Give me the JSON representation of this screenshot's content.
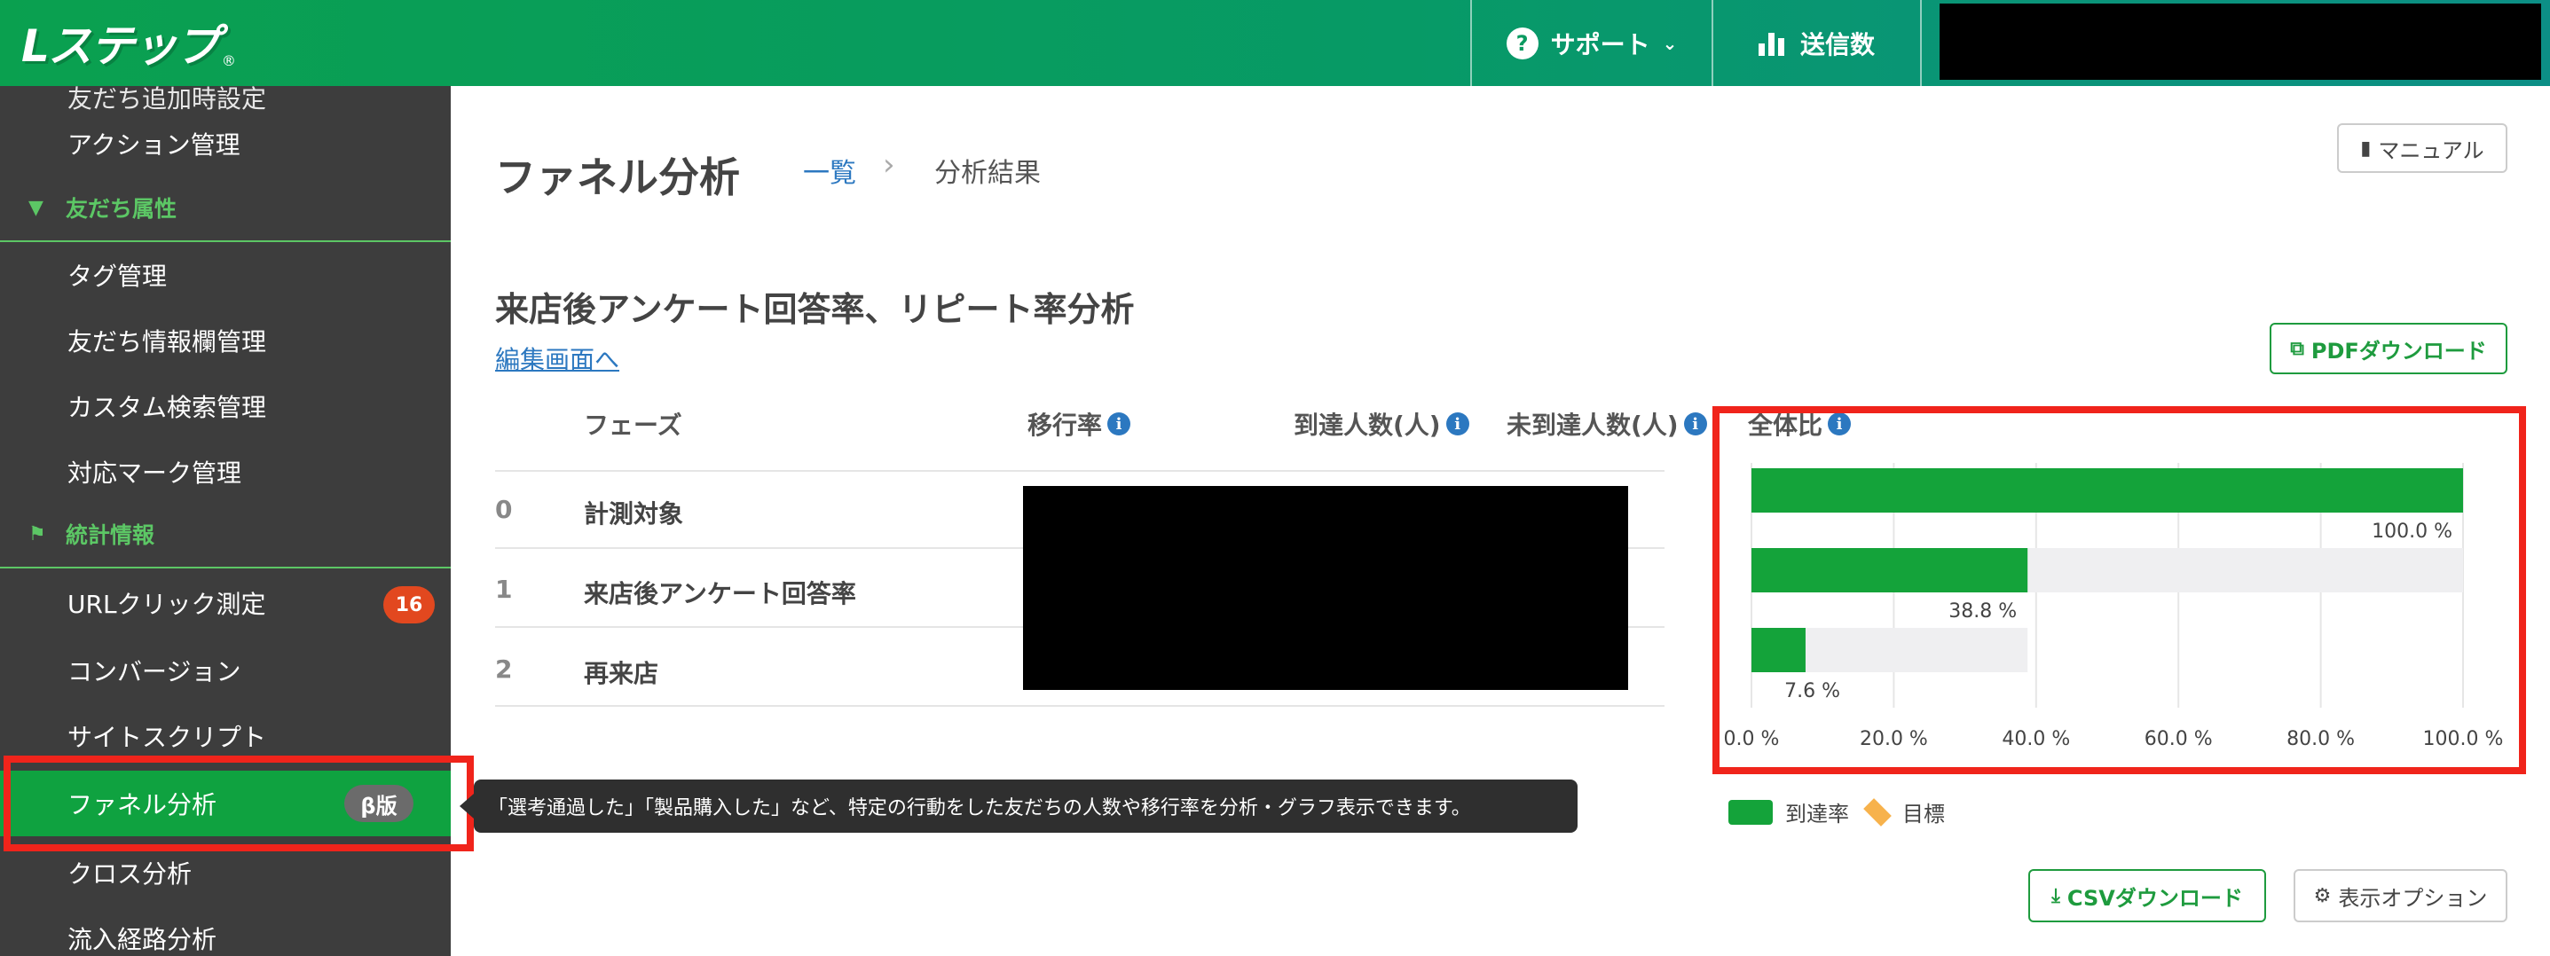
{
  "app": {
    "logo": "Lステップ",
    "logo_mark": "®"
  },
  "topbar": {
    "support_label": "サポート",
    "support_icon": "question-circle-icon",
    "sent_label": "送信数",
    "sent_icon": "bar-chart-icon"
  },
  "sidebar": {
    "cut_item": "友だち追加時設定",
    "items_top": [
      {
        "label": "アクション管理"
      }
    ],
    "section_attr": {
      "label": "友だち属性",
      "icon": "filter-icon"
    },
    "items_attr": [
      {
        "label": "タグ管理"
      },
      {
        "label": "友だち情報欄管理"
      },
      {
        "label": "カスタム検索管理"
      },
      {
        "label": "対応マーク管理"
      }
    ],
    "section_stats": {
      "label": "統計情報",
      "icon": "flag-icon"
    },
    "items_stats": [
      {
        "label": "URLクリック測定",
        "badge": "16"
      },
      {
        "label": "コンバージョン"
      },
      {
        "label": "サイトスクリプト"
      },
      {
        "label": "ファネル分析",
        "badge": "β版"
      },
      {
        "label": "クロス分析"
      },
      {
        "label": "流入経路分析"
      }
    ]
  },
  "tooltip": {
    "text": "「選考通過した」「製品購入した」など、特定の行動をした友だちの人数や移行率を分析・グラフ表示できます。"
  },
  "header": {
    "title": "ファネル分析",
    "breadcrumb_link": "一覧",
    "breadcrumb_sep": "›",
    "breadcrumb_current": "分析結果",
    "manual_button": "マニュアル"
  },
  "analysis": {
    "title": "来店後アンケート回答率、リピート率分析",
    "edit_link": "編集画面へ",
    "pdf_button": "PDFダウンロード",
    "columns": {
      "phase": "フェーズ",
      "rate": "移行率",
      "reached": "到達人数(人)",
      "not_reached": "未到達人数(人)",
      "ratio": "全体比"
    },
    "rows": [
      {
        "idx": "0",
        "phase": "計測対象"
      },
      {
        "idx": "1",
        "phase": "来店後アンケート回答率"
      },
      {
        "idx": "2",
        "phase": "再来店"
      }
    ]
  },
  "chart_data": {
    "type": "bar",
    "orientation": "horizontal",
    "categories": [
      "計測対象",
      "来店後アンケート回答率",
      "再来店"
    ],
    "series": [
      {
        "name": "到達率",
        "values": [
          100.0,
          38.8,
          7.6
        ]
      }
    ],
    "background_values": [
      100.0,
      100.0,
      38.8
    ],
    "value_labels": [
      "100.0 %",
      "38.8 %",
      "7.6 %"
    ],
    "xlim": [
      0,
      100
    ],
    "x_ticks": [
      "0.0 %",
      "20.0 %",
      "40.0 %",
      "60.0 %",
      "80.0 %",
      "100.0 %"
    ],
    "grid": true,
    "legend": [
      {
        "name": "到達率",
        "color": "#14a33a"
      },
      {
        "name": "目標",
        "color": "#f7b24c"
      }
    ],
    "legend_position": "bottom-left"
  },
  "footer": {
    "csv_button": "CSVダウンロード",
    "options_button": "表示オプション"
  },
  "colors": {
    "accent": "#14a33a",
    "link": "#2c78c0",
    "highlight": "#f0241b",
    "badge": "#e2481f"
  }
}
